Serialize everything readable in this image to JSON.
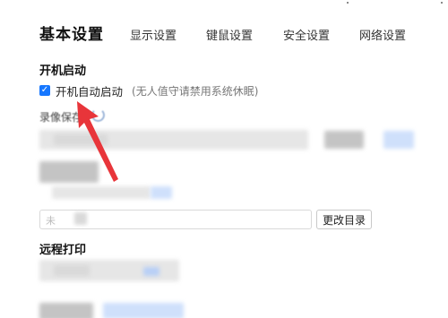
{
  "tabs": {
    "active": "基本设置",
    "items": [
      "显示设置",
      "键鼠设置",
      "安全设置",
      "网络设置"
    ]
  },
  "startup": {
    "section_title": "开机启动",
    "checkbox_label": "开机自动启动",
    "checkbox_checked": true,
    "checkbox_hint": "(无人值守请禁用系统休眠)"
  },
  "recording": {
    "section_title_partial": "录像保存"
  },
  "path": {
    "input_prefix": "未",
    "change_button": "更改目录"
  },
  "remote_print": {
    "section_title": "远程打印"
  },
  "colors": {
    "accent": "#1677ff",
    "annotation_arrow": "#e8353a"
  }
}
